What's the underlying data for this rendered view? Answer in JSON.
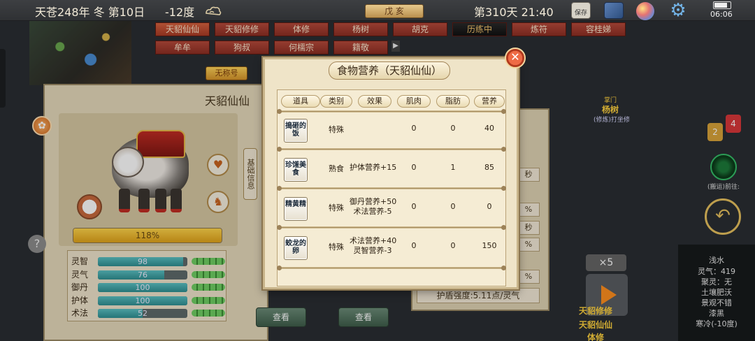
{
  "status": {
    "calendar": "天苍248年 冬 第10日",
    "temperature": "-12度",
    "season_badge": "戊 亥",
    "day_time": "第310天 21:40",
    "save_label": "保存",
    "clock": "06:06"
  },
  "name_tabs": [
    "天貂仙仙",
    "天貂修修",
    "体修",
    "杨树",
    "胡克",
    "历练中",
    "炼符",
    "容桂娣",
    "牟牟",
    "狗叔",
    "何檽宗",
    "籍敬"
  ],
  "character": {
    "no_title": "无称号",
    "name": "天貂仙仙",
    "growth_text": "118%",
    "growth_value": 1.18,
    "base_info_tab": "基础信息",
    "stats": [
      {
        "name": "灵智",
        "value": "98",
        "fill": 0.95
      },
      {
        "name": "灵气",
        "value": "76",
        "fill": 0.74
      },
      {
        "name": "御丹",
        "value": "100",
        "fill": 1.0
      },
      {
        "name": "护体",
        "value": "100",
        "fill": 1.0
      },
      {
        "name": "术法",
        "value": "52",
        "fill": 0.5
      }
    ]
  },
  "right_panel": {
    "shield_strength": "护盾强度:5.11点/灵气",
    "cells": [
      "秒",
      "%",
      "秒",
      "%",
      "%"
    ],
    "view_buttons": [
      "查看",
      "查看"
    ]
  },
  "dialog": {
    "title": "食物营养（天貂仙仙）",
    "close": "✕",
    "columns": [
      "道具",
      "类别",
      "效果",
      "肌肉",
      "脂肪",
      "营养"
    ],
    "rows": [
      {
        "icon_text": "搗砸的饭",
        "category": "特殊",
        "effect": "",
        "muscle": "0",
        "fat": "0",
        "nutrition": "40"
      },
      {
        "icon_text": "珍馐美食",
        "category": "熟食",
        "effect": "护体营养+15",
        "muscle": "0",
        "fat": "1",
        "nutrition": "85"
      },
      {
        "icon_text": "精黄精",
        "category": "特殊",
        "effect": "御丹营养+50\n术法营养-5",
        "muscle": "0",
        "fat": "0",
        "nutrition": "0"
      },
      {
        "icon_text": "蛟龙的卵",
        "category": "特殊",
        "effect": "术法营养+40\n灵智营养-3",
        "muscle": "0",
        "fat": "0",
        "nutrition": "150"
      }
    ]
  },
  "hud": {
    "master_label": "掌门",
    "master_name": "杨树",
    "master_action": "(修炼)打坐修",
    "chat_yellow": "2",
    "chat_red": "4",
    "transport_label": "(搬运)前往:",
    "speed_badge": "×5",
    "names": [
      "天貂修修",
      "天貂仙仙",
      "体修"
    ],
    "environment": [
      "浅水",
      "灵气：419",
      "聚灵：无",
      "土壤肥沃",
      "景观不错",
      "漆黑",
      "寒冷(-10度)"
    ]
  }
}
